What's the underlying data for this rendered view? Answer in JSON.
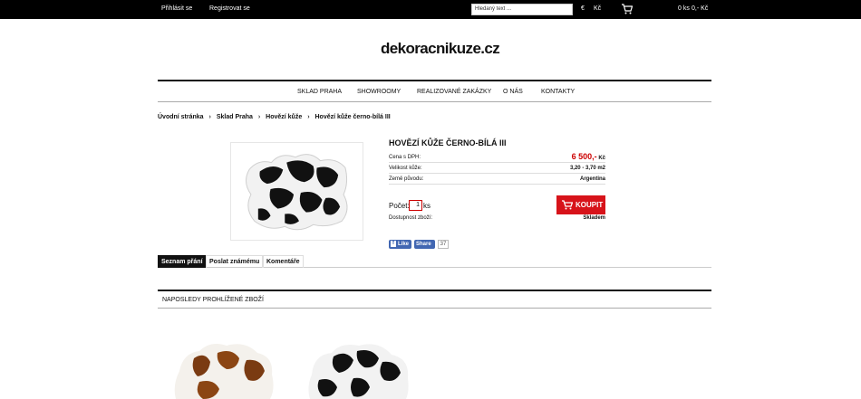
{
  "topbar": {
    "login": "Přihlásit se",
    "register": "Registrovat se",
    "search_placeholder": "Hledaný text ...",
    "currency_symbol": "€",
    "currency_code": "Kč",
    "cart_count": "0 ks",
    "cart_total": "0,- Kč"
  },
  "site": {
    "logo": "dekoracnikuze.cz"
  },
  "nav": [
    "SKLAD PRAHA",
    "SHOWROOMY",
    "REALIZOVANÉ ZAKÁZKY",
    "O NÁS",
    "KONTAKTY"
  ],
  "breadcrumb": [
    "Úvodní stránka",
    "Sklad Praha",
    "Hovězí kůže",
    "Hovězí kůže černo-bílá III"
  ],
  "product": {
    "title": "HOVĚZÍ KŮŽE ČERNO-BÍLÁ III",
    "price_label": "Cena s DPH:",
    "price_value": "6 500,-",
    "price_currency": "Kč",
    "size_label": "Velikost kůže:",
    "size_value": "3,20 - 3,70 m2",
    "origin_label": "Země původu:",
    "origin_value": "Argentina",
    "qty_label": "Počet:",
    "qty_value": "1",
    "qty_unit": "ks",
    "buy_label": "KOUPIT",
    "avail_label": "Dostupnost zboží:",
    "avail_value": "Skladem"
  },
  "social": {
    "like": "Like",
    "share": "Share",
    "count": "37"
  },
  "tabs": [
    "Seznam přání",
    "Poslat známému",
    "Komentáře"
  ],
  "recent": {
    "heading": "NAPOSLEDY PROHLÍŽENÉ ZBOŽÍ"
  },
  "colors": {
    "accent": "#d7131a",
    "topbar": "#000000",
    "facebook": "#4267b2"
  }
}
